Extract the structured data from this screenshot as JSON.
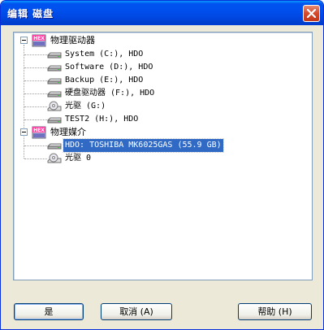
{
  "window": {
    "title": "编辑 磁盘"
  },
  "tree": {
    "roots": [
      {
        "label": "物理驱动器",
        "icon": "hex-drive-icon",
        "children": [
          {
            "label": "System (C:), HDO",
            "icon": "hard-drive-icon"
          },
          {
            "label": "Software (D:), HDO",
            "icon": "hard-drive-icon"
          },
          {
            "label": "Backup (E:), HDO",
            "icon": "hard-drive-icon"
          },
          {
            "label": "硬盘驱动器 (F:), HDO",
            "icon": "hard-drive-icon"
          },
          {
            "label": "光驱 (G:)",
            "icon": "cd-drive-icon"
          },
          {
            "label": "TEST2 (H:), HDO",
            "icon": "hard-drive-icon"
          }
        ]
      },
      {
        "label": "物理媒介",
        "icon": "hex-drive-icon",
        "children": [
          {
            "label": "HDO: TOSHIBA MK6025GAS (55.9 GB)",
            "icon": "hard-drive-icon",
            "selected": true
          },
          {
            "label": "光驱 0",
            "icon": "cd-drive-icon"
          }
        ]
      }
    ]
  },
  "buttons": {
    "ok": "是",
    "cancel": "取消 (A)",
    "help": "帮助 (H)"
  },
  "colors": {
    "selection": "#316ac5",
    "titlebar": "#0050ee",
    "dialog_bg": "#ece9d8"
  }
}
